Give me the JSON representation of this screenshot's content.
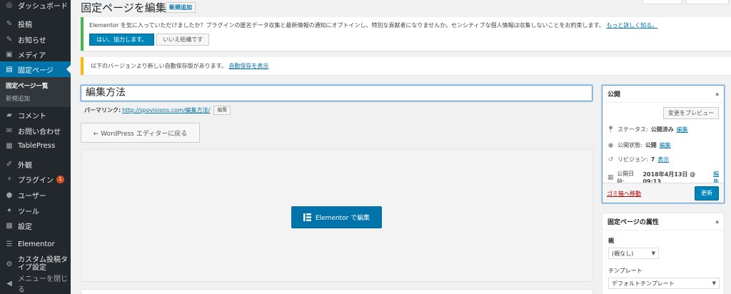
{
  "sidebar": {
    "items": [
      {
        "icon": "dashboard-icon",
        "glyph": "◎",
        "label": "ダッシュボード"
      },
      {
        "icon": "pin-icon",
        "glyph": "✎",
        "label": "投稿"
      },
      {
        "icon": "pin-icon",
        "glyph": "✎",
        "label": "お知らせ"
      },
      {
        "icon": "media-icon",
        "glyph": "▣",
        "label": "メディア"
      },
      {
        "icon": "page-icon",
        "glyph": "▤",
        "label": "固定ページ"
      },
      {
        "icon": "comment-icon",
        "glyph": "▰",
        "label": "コメント"
      },
      {
        "icon": "mail-icon",
        "glyph": "✉",
        "label": "お問い合わせ"
      },
      {
        "icon": "table-icon",
        "glyph": "▦",
        "label": "TablePress"
      },
      {
        "icon": "appearance-icon",
        "glyph": "✐",
        "label": "外観"
      },
      {
        "icon": "plugin-icon",
        "glyph": "⚡",
        "label": "プラグイン",
        "badge": "1"
      },
      {
        "icon": "user-icon",
        "glyph": "●",
        "label": "ユーザー"
      },
      {
        "icon": "tools-icon",
        "glyph": "✦",
        "label": "ツール"
      },
      {
        "icon": "settings-icon",
        "glyph": "▩",
        "label": "設定"
      },
      {
        "icon": "elementor-icon",
        "glyph": "☰",
        "label": "Elementor"
      },
      {
        "icon": "custom-post-icon",
        "glyph": "⚙",
        "label": "カスタム投稿タイプ設定"
      },
      {
        "icon": "collapse-icon",
        "glyph": "◀",
        "label": "メニューを閉じる"
      }
    ],
    "submenu": [
      "固定ページ一覧",
      "新規追加"
    ]
  },
  "header": {
    "title": "固定ページを編集",
    "add_new": "新規追加"
  },
  "notice_elementor": {
    "text": "Elementor を気に入っていただけましたか？プラグインの匿名データ収集と最新情報の通知にオプトインし、特別な貢献者になりませんか。センシティブな個人情報は収集しないことをお約束します。",
    "link": "もっと詳しく知る。",
    "accept": "はい、協力します。",
    "decline": "いいえ結構です"
  },
  "notice_autosave": {
    "text": "以下のバージョンより新しい自動保存版があります。",
    "link": "自動保存を表示"
  },
  "editor": {
    "title_value": "編集方法",
    "permalink_label": "パーマリンク:",
    "permalink_base": "http://spovisions.com/",
    "permalink_slug": "編集方法",
    "permalink_tail": "/",
    "permalink_edit": "編集",
    "back_button": "← WordPress エディターに戻る",
    "elementor_button": "Elementor で編集"
  },
  "publish": {
    "title": "公開",
    "preview": "変更をプレビュー",
    "status_label": "ステータス:",
    "status_value": "公開済み",
    "visibility_label": "公開状態:",
    "visibility_value": "公開",
    "revisions_label": "リビジョン:",
    "revisions_value": "7",
    "revisions_link": "表示",
    "date_label": "公開日時:",
    "date_value": "2018年4月13日 @ 09:13",
    "edit_link": "編集",
    "trash": "ゴミ箱へ移動",
    "update": "更新"
  },
  "attributes": {
    "title": "固定ページの属性",
    "parent_label": "親",
    "parent_value": "(親なし)",
    "template_label": "テンプレート",
    "template_value": "デフォルトテンプレート"
  },
  "colors": {
    "admin_bar": "#23282d",
    "accent": "#0073aa",
    "success": "#46b450",
    "warning": "#ffb900"
  }
}
